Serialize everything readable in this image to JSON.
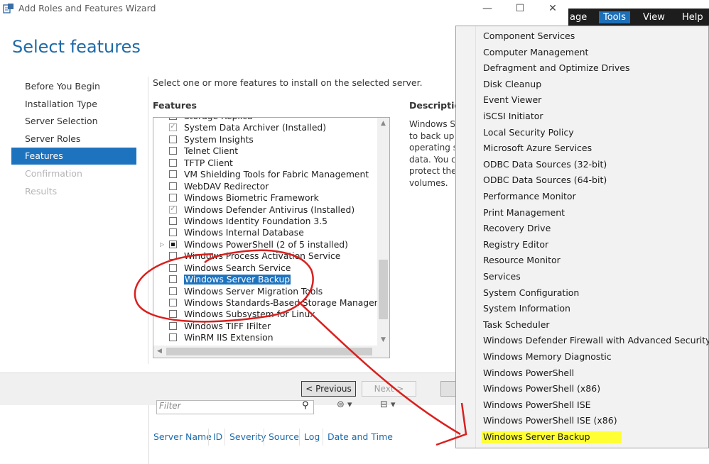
{
  "window": {
    "title": "Add Roles and Features Wizard",
    "min": "—",
    "max": "☐",
    "close": "✕"
  },
  "menubar": {
    "manage": "age",
    "tools": "Tools",
    "view": "View",
    "help": "Help"
  },
  "page_title": "Select features",
  "nav": [
    "Before You Begin",
    "Installation Type",
    "Server Selection",
    "Server Roles",
    "Features",
    "Confirmation",
    "Results"
  ],
  "instruction": "Select one or more features to install on the selected server.",
  "features_heading": "Features",
  "description_heading": "Description",
  "description_lines": [
    "Windows Se",
    "to back up a",
    "operating sy",
    "data. You ca",
    "protect the",
    "volumes."
  ],
  "features": [
    {
      "label": "Storage Replica",
      "state": "none"
    },
    {
      "label": "System Data Archiver (Installed)",
      "state": "checked"
    },
    {
      "label": "System Insights",
      "state": "none"
    },
    {
      "label": "Telnet Client",
      "state": "none"
    },
    {
      "label": "TFTP Client",
      "state": "none"
    },
    {
      "label": "VM Shielding Tools for Fabric Management",
      "state": "none"
    },
    {
      "label": "WebDAV Redirector",
      "state": "none"
    },
    {
      "label": "Windows Biometric Framework",
      "state": "none"
    },
    {
      "label": "Windows Defender Antivirus (Installed)",
      "state": "checked"
    },
    {
      "label": "Windows Identity Foundation 3.5",
      "state": "none"
    },
    {
      "label": "Windows Internal Database",
      "state": "none"
    },
    {
      "label": "Windows PowerShell (2 of 5 installed)",
      "state": "partial",
      "expander": true
    },
    {
      "label": "Windows Process Activation Service",
      "state": "none"
    },
    {
      "label": "Windows Search Service",
      "state": "none"
    },
    {
      "label": "Windows Server Backup",
      "state": "none",
      "selected": true
    },
    {
      "label": "Windows Server Migration Tools",
      "state": "none"
    },
    {
      "label": "Windows Standards-Based Storage Management",
      "state": "none"
    },
    {
      "label": "Windows Subsystem for Linux",
      "state": "none"
    },
    {
      "label": "Windows TIFF IFilter",
      "state": "none"
    },
    {
      "label": "WinRM IIS Extension",
      "state": "none"
    }
  ],
  "buttons": {
    "previous": "< Previous",
    "next": "Next >"
  },
  "server_manager": {
    "filter_placeholder": "Filter",
    "columns": [
      "Server Name",
      "ID",
      "Severity",
      "Source",
      "Log",
      "Date and Time"
    ]
  },
  "tools_menu": [
    "Component Services",
    "Computer Management",
    "Defragment and Optimize Drives",
    "Disk Cleanup",
    "Event Viewer",
    "iSCSI Initiator",
    "Local Security Policy",
    "Microsoft Azure Services",
    "ODBC Data Sources (32-bit)",
    "ODBC Data Sources (64-bit)",
    "Performance Monitor",
    "Print Management",
    "Recovery Drive",
    "Registry Editor",
    "Resource Monitor",
    "Services",
    "System Configuration",
    "System Information",
    "Task Scheduler",
    "Windows Defender Firewall with Advanced Security",
    "Windows Memory Diagnostic",
    "Windows PowerShell",
    "Windows PowerShell (x86)",
    "Windows PowerShell ISE",
    "Windows PowerShell ISE (x86)",
    "Windows Server Backup"
  ],
  "colors": {
    "accent": "#1e73be",
    "annotation": "#d9201e",
    "highlight": "#ffff33",
    "menubar": "#1d1d1d"
  }
}
